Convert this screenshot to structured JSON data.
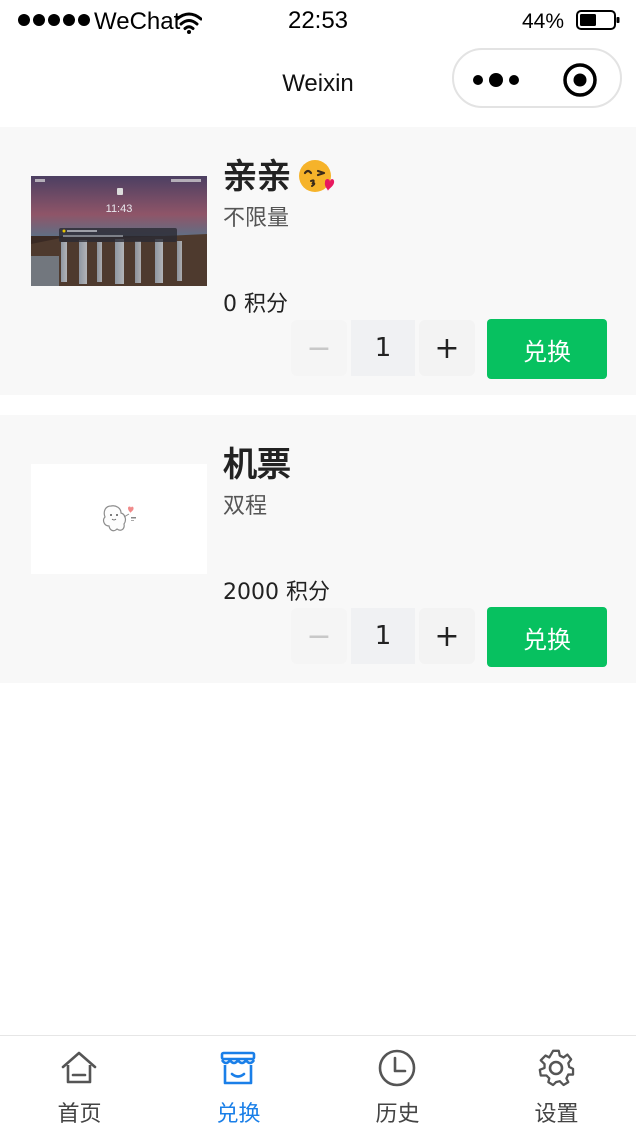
{
  "status_bar": {
    "carrier": "WeChat",
    "time": "22:53",
    "battery": "44%"
  },
  "nav": {
    "title": "Weixin"
  },
  "products": [
    {
      "title": "亲亲",
      "title_emoji": "kissing-face",
      "subtitle": "不限量",
      "points": "0 积分",
      "quantity": "1",
      "exchange_label": "兑换",
      "image_text": "11:43"
    },
    {
      "title": "机票",
      "subtitle": "双程",
      "points": "2000 积分",
      "quantity": "1",
      "exchange_label": "兑换"
    }
  ],
  "stepper": {
    "minus": "−",
    "plus": "+"
  },
  "tabs": [
    {
      "label": "首页",
      "icon": "home-icon",
      "active": false
    },
    {
      "label": "兑换",
      "icon": "store-icon",
      "active": true
    },
    {
      "label": "历史",
      "icon": "clock-icon",
      "active": false
    },
    {
      "label": "设置",
      "icon": "gear-icon",
      "active": false
    }
  ],
  "colors": {
    "accent_green": "#07c160",
    "active_tab_blue": "#1a7fe8"
  }
}
